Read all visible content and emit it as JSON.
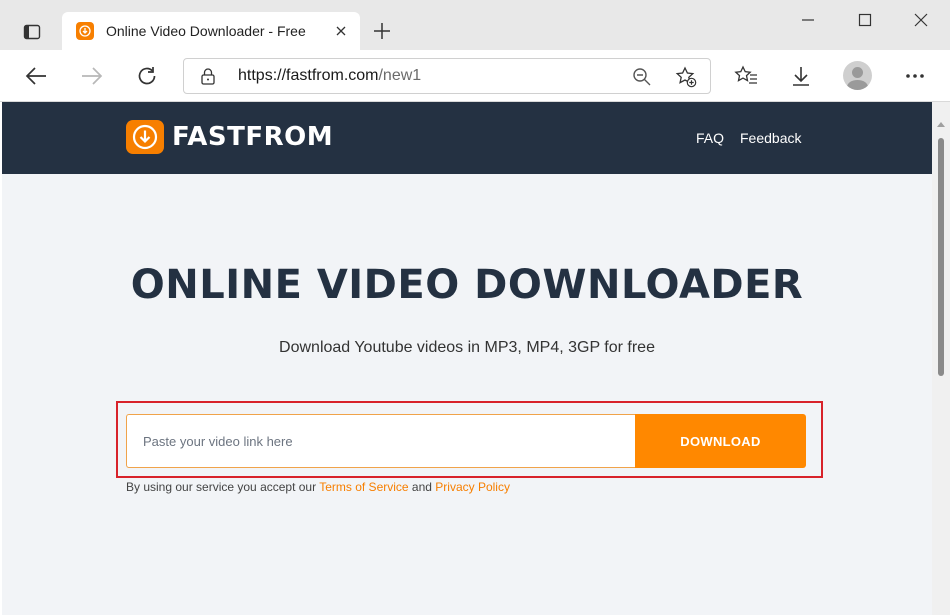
{
  "browser": {
    "tab": {
      "title": "Online Video Downloader - Free"
    },
    "address_bar": {
      "url_host": "https://fastfrom.com",
      "url_path": "/new1"
    },
    "icons": {
      "tab_actions": "tab-actions-icon",
      "favicon": "download-icon",
      "close": "close-icon",
      "new_tab": "plus-icon",
      "minimize": "minimize-icon",
      "maximize": "maximize-icon",
      "close_window": "close-icon",
      "back": "arrow-left-icon",
      "forward": "arrow-right-icon",
      "refresh": "refresh-icon",
      "lock": "lock-icon",
      "zoom": "zoom-icon",
      "add_favorite": "star-add-icon",
      "favorites": "favorites-icon",
      "downloads": "download-icon",
      "profile": "avatar",
      "menu": "more-icon"
    }
  },
  "site": {
    "brand": "FASTFROM",
    "nav": [
      {
        "label": "FAQ"
      },
      {
        "label": "Feedback"
      }
    ],
    "hero": {
      "title": "ONLINE VIDEO DOWNLOADER",
      "subtitle": "Download Youtube videos in MP3, MP4, 3GP for free"
    },
    "form": {
      "input_value": "",
      "input_placeholder": "Paste your video link here",
      "button_label": "DOWNLOAD"
    },
    "terms": {
      "prefix": "By using our service you accept our ",
      "tos_label": "Terms of Service",
      "and": " and ",
      "privacy_label": "Privacy Policy"
    },
    "colors": {
      "header_bg": "#243142",
      "accent": "#ff8800",
      "page_bg": "#f2f4f7",
      "highlight": "#d8222a"
    }
  }
}
